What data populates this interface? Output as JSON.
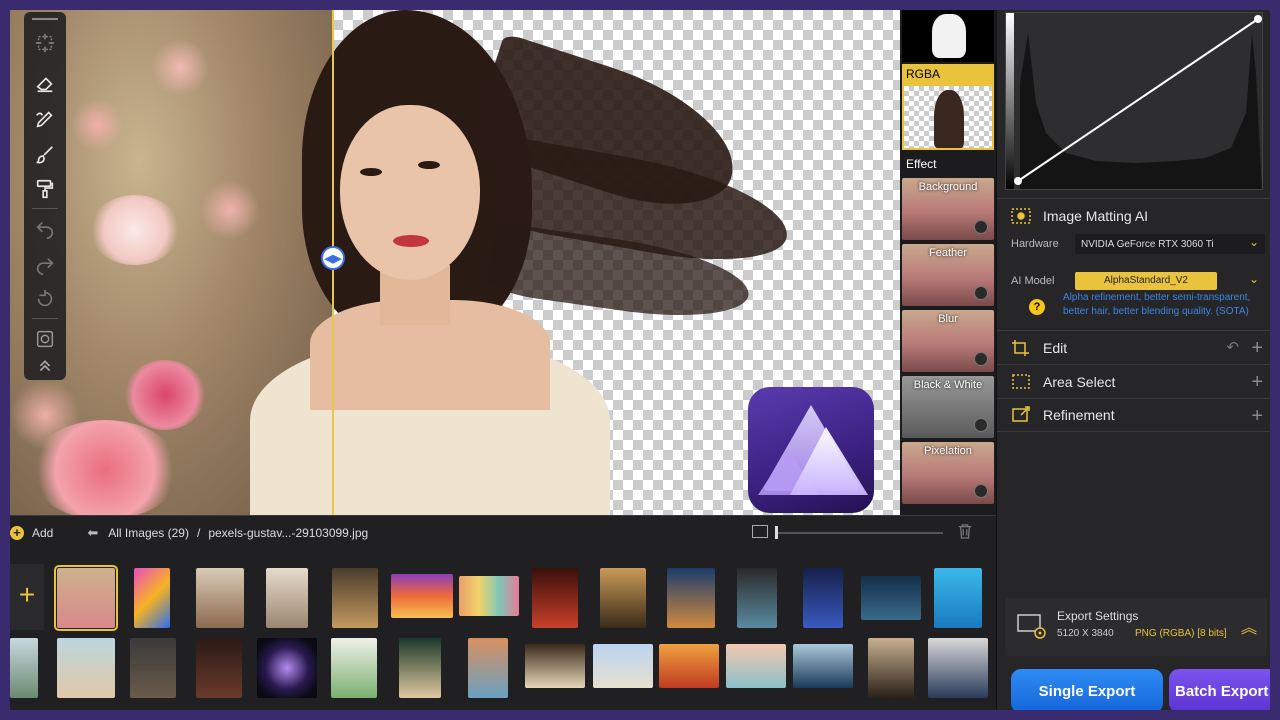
{
  "toolbar": {
    "tools": [
      "move-icon",
      "eraser-icon",
      "pen-icon",
      "brush-icon",
      "roller-icon",
      "undo-icon",
      "redo-icon",
      "reset-icon",
      "mask-icon",
      "collapse-icon"
    ]
  },
  "right_thumbs": {
    "rgba_label": "RGBA",
    "effect_header": "Effect",
    "effects": [
      "Background",
      "Feather",
      "Blur",
      "Black & White",
      "Pixelation"
    ]
  },
  "matting": {
    "title": "Image Matting AI",
    "hardware_label": "Hardware",
    "hardware_value": "NVIDIA GeForce RTX 3060 Ti",
    "model_label": "AI Model",
    "model_value": "AlphaStandard_V2",
    "description": "Alpha refinement, better semi-transparent, better hair, better blending quality. (SOTA)"
  },
  "sections": {
    "edit": "Edit",
    "area_select": "Area Select",
    "refinement": "Refinement"
  },
  "export": {
    "title": "Export Settings",
    "size": "5120 X 3840",
    "format": "PNG (RGBA) [8 bits]",
    "single_label": "Single Export",
    "batch_label": "Batch Export"
  },
  "browser": {
    "add_label": "Add",
    "all_images": "All Images (29)",
    "separator": "/",
    "filename": "pexels-gustav...-29103099.jpg"
  },
  "colors": {
    "accent_yellow": "#e8c33b",
    "single_export": "#1f7ae6",
    "batch_export": "#6a44e0",
    "link_blue": "#3d85e0"
  }
}
